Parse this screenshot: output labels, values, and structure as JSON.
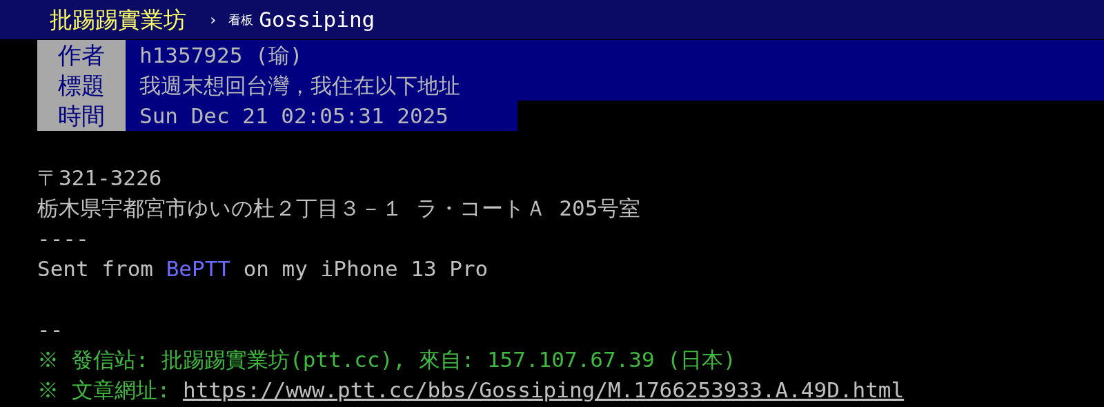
{
  "top_bar": {
    "site_title": "批踢踢實業坊",
    "separator": "›",
    "board_label": "看板",
    "board_name": "Gossiping"
  },
  "header": [
    {
      "label": "作者",
      "value": "h1357925 (瑜)"
    },
    {
      "label": "標題",
      "value": "我週末想回台灣，我住在以下地址"
    },
    {
      "label": "時間",
      "value": "Sun Dec 21 02:05:31 2025"
    }
  ],
  "lines": [
    {
      "kind": "blank"
    },
    {
      "kind": "text",
      "segments": [
        {
          "kind": "plain",
          "text": "〒321-3226"
        }
      ]
    },
    {
      "kind": "text",
      "segments": [
        {
          "kind": "plain",
          "text": "栃木県宇都宮市ゆいの杜２丁目３－１ ラ・コートＡ 205号室"
        }
      ]
    },
    {
      "kind": "text",
      "segments": [
        {
          "kind": "plain",
          "text": "----"
        }
      ]
    },
    {
      "kind": "text",
      "segments": [
        {
          "kind": "plain",
          "text": "Sent from "
        },
        {
          "kind": "link",
          "text": "BePTT"
        },
        {
          "kind": "plain",
          "text": " on my iPhone 13 Pro"
        }
      ]
    },
    {
      "kind": "blank"
    },
    {
      "kind": "text",
      "segments": [
        {
          "kind": "plain",
          "text": "--"
        }
      ]
    },
    {
      "kind": "text",
      "segments": [
        {
          "kind": "green",
          "text": "※ 發信站: 批踢踢實業坊(ptt.cc), 來自: 157.107.67.39 (日本)"
        }
      ]
    },
    {
      "kind": "text",
      "segments": [
        {
          "kind": "green",
          "text": "※ 文章網址: "
        },
        {
          "kind": "url",
          "text": "https://www.ptt.cc/bbs/Gossiping/M.1766253933.A.49D.html"
        }
      ]
    }
  ]
}
